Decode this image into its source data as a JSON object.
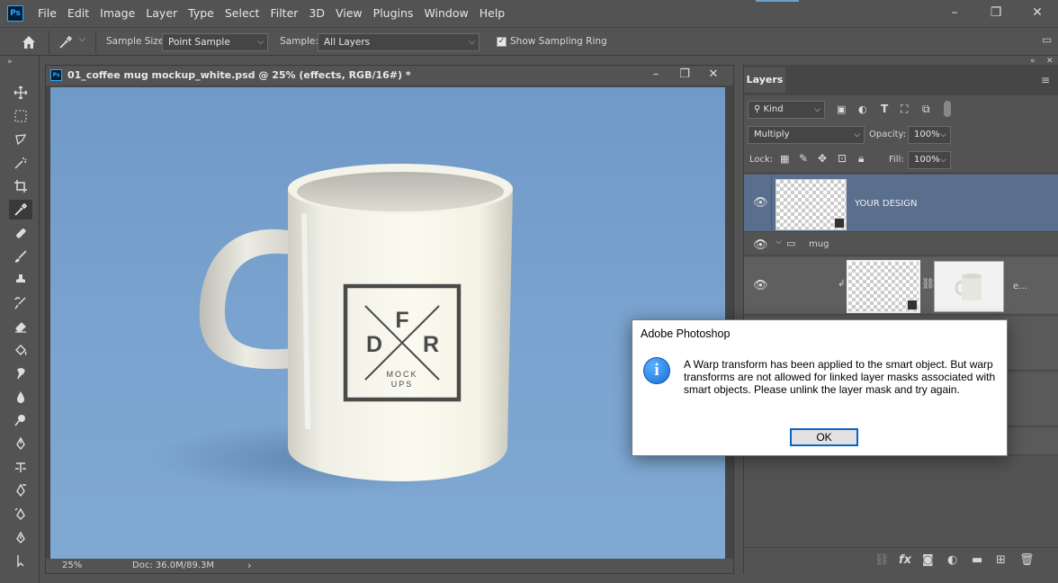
{
  "app": {
    "logo_text": "Ps",
    "menu": [
      "File",
      "Edit",
      "Image",
      "Layer",
      "Type",
      "Select",
      "Filter",
      "3D",
      "View",
      "Plugins",
      "Window",
      "Help"
    ],
    "window_controls": [
      "–",
      "❐",
      "✕"
    ]
  },
  "options_bar": {
    "sample_size_label": "Sample Size:",
    "sample_size_value": "Point Sample",
    "sample_label": "Sample:",
    "sample_value": "All Layers",
    "sampling_ring_label": "Show Sampling Ring",
    "sampling_ring_checked": true
  },
  "document": {
    "title": "01_coffee mug mockup_white.psd @ 25% (effects, RGB/16#) *",
    "ps_icon": "Ps",
    "zoom": "25%",
    "doc_size": "Doc: 36.0M/89.3M",
    "logo": {
      "letters": [
        "D",
        "F",
        "R"
      ],
      "subtext": [
        "MOCK",
        "UPS"
      ]
    },
    "controls": [
      "–",
      "❐",
      "✕"
    ]
  },
  "layers_panel": {
    "tab_label": "Layers",
    "kind_filter": "Kind",
    "blend_mode": "Multiply",
    "opacity_label": "Opacity:",
    "opacity_value": "100%",
    "lock_label": "Lock:",
    "fill_label": "Fill:",
    "fill_value": "100%",
    "layers": [
      {
        "name": "YOUR DESIGN",
        "type": "smart-object",
        "visible": true,
        "selected": true
      },
      {
        "name": "mug",
        "type": "group",
        "visible": true,
        "expanded": true
      },
      {
        "name": "e...",
        "type": "smart-object-with-mask",
        "visible": true
      }
    ]
  },
  "dialog": {
    "title": "Adobe Photoshop",
    "icon": "info-icon",
    "message": "A Warp transform has been applied to the smart object. But warp transforms are not allowed for linked layer masks associated with smart objects. Please unlink the layer mask and try again.",
    "ok_label": "OK"
  }
}
